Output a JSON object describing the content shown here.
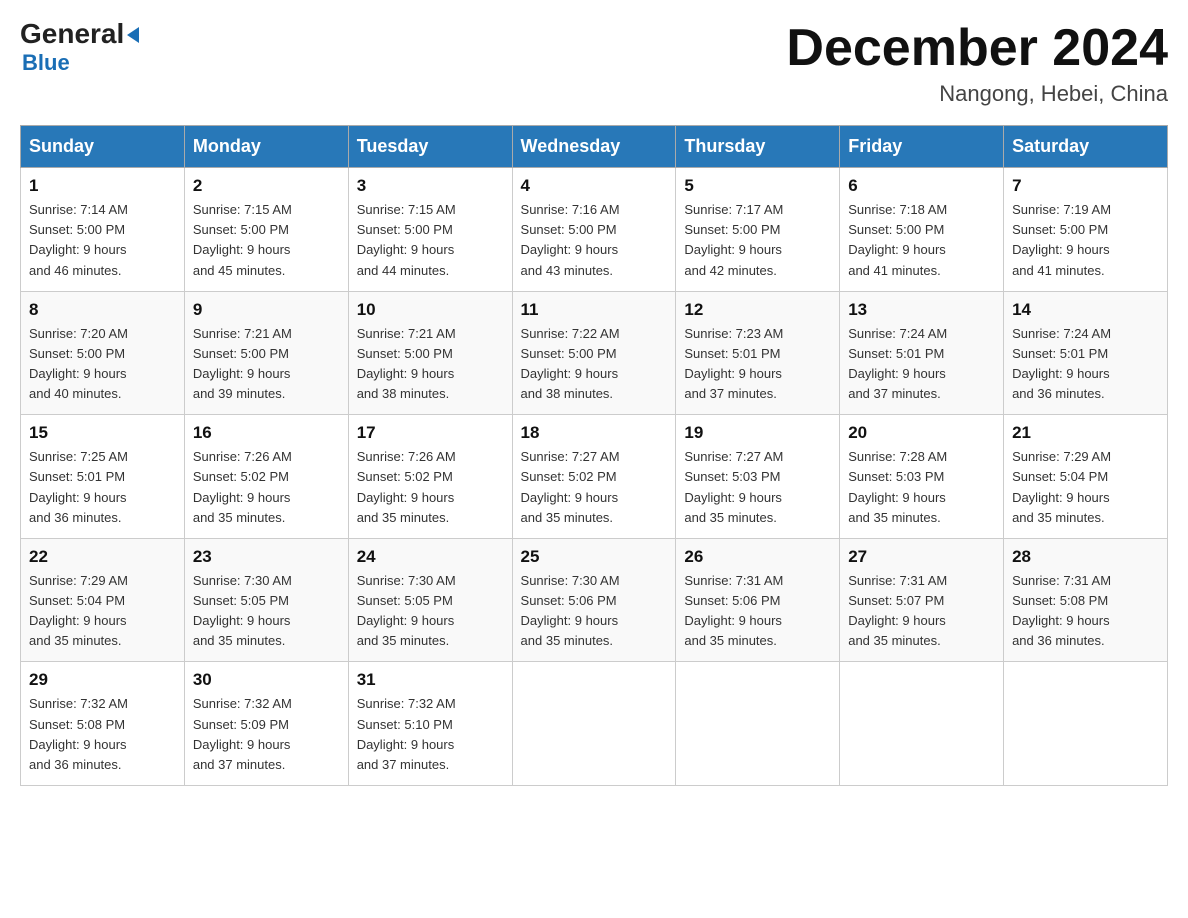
{
  "header": {
    "logo_general": "General",
    "logo_blue": "Blue",
    "month_year": "December 2024",
    "location": "Nangong, Hebei, China"
  },
  "days_of_week": [
    "Sunday",
    "Monday",
    "Tuesday",
    "Wednesday",
    "Thursday",
    "Friday",
    "Saturday"
  ],
  "weeks": [
    [
      {
        "day": "1",
        "sunrise": "7:14 AM",
        "sunset": "5:00 PM",
        "daylight": "9 hours and 46 minutes."
      },
      {
        "day": "2",
        "sunrise": "7:15 AM",
        "sunset": "5:00 PM",
        "daylight": "9 hours and 45 minutes."
      },
      {
        "day": "3",
        "sunrise": "7:15 AM",
        "sunset": "5:00 PM",
        "daylight": "9 hours and 44 minutes."
      },
      {
        "day": "4",
        "sunrise": "7:16 AM",
        "sunset": "5:00 PM",
        "daylight": "9 hours and 43 minutes."
      },
      {
        "day": "5",
        "sunrise": "7:17 AM",
        "sunset": "5:00 PM",
        "daylight": "9 hours and 42 minutes."
      },
      {
        "day": "6",
        "sunrise": "7:18 AM",
        "sunset": "5:00 PM",
        "daylight": "9 hours and 41 minutes."
      },
      {
        "day": "7",
        "sunrise": "7:19 AM",
        "sunset": "5:00 PM",
        "daylight": "9 hours and 41 minutes."
      }
    ],
    [
      {
        "day": "8",
        "sunrise": "7:20 AM",
        "sunset": "5:00 PM",
        "daylight": "9 hours and 40 minutes."
      },
      {
        "day": "9",
        "sunrise": "7:21 AM",
        "sunset": "5:00 PM",
        "daylight": "9 hours and 39 minutes."
      },
      {
        "day": "10",
        "sunrise": "7:21 AM",
        "sunset": "5:00 PM",
        "daylight": "9 hours and 38 minutes."
      },
      {
        "day": "11",
        "sunrise": "7:22 AM",
        "sunset": "5:00 PM",
        "daylight": "9 hours and 38 minutes."
      },
      {
        "day": "12",
        "sunrise": "7:23 AM",
        "sunset": "5:01 PM",
        "daylight": "9 hours and 37 minutes."
      },
      {
        "day": "13",
        "sunrise": "7:24 AM",
        "sunset": "5:01 PM",
        "daylight": "9 hours and 37 minutes."
      },
      {
        "day": "14",
        "sunrise": "7:24 AM",
        "sunset": "5:01 PM",
        "daylight": "9 hours and 36 minutes."
      }
    ],
    [
      {
        "day": "15",
        "sunrise": "7:25 AM",
        "sunset": "5:01 PM",
        "daylight": "9 hours and 36 minutes."
      },
      {
        "day": "16",
        "sunrise": "7:26 AM",
        "sunset": "5:02 PM",
        "daylight": "9 hours and 35 minutes."
      },
      {
        "day": "17",
        "sunrise": "7:26 AM",
        "sunset": "5:02 PM",
        "daylight": "9 hours and 35 minutes."
      },
      {
        "day": "18",
        "sunrise": "7:27 AM",
        "sunset": "5:02 PM",
        "daylight": "9 hours and 35 minutes."
      },
      {
        "day": "19",
        "sunrise": "7:27 AM",
        "sunset": "5:03 PM",
        "daylight": "9 hours and 35 minutes."
      },
      {
        "day": "20",
        "sunrise": "7:28 AM",
        "sunset": "5:03 PM",
        "daylight": "9 hours and 35 minutes."
      },
      {
        "day": "21",
        "sunrise": "7:29 AM",
        "sunset": "5:04 PM",
        "daylight": "9 hours and 35 minutes."
      }
    ],
    [
      {
        "day": "22",
        "sunrise": "7:29 AM",
        "sunset": "5:04 PM",
        "daylight": "9 hours and 35 minutes."
      },
      {
        "day": "23",
        "sunrise": "7:30 AM",
        "sunset": "5:05 PM",
        "daylight": "9 hours and 35 minutes."
      },
      {
        "day": "24",
        "sunrise": "7:30 AM",
        "sunset": "5:05 PM",
        "daylight": "9 hours and 35 minutes."
      },
      {
        "day": "25",
        "sunrise": "7:30 AM",
        "sunset": "5:06 PM",
        "daylight": "9 hours and 35 minutes."
      },
      {
        "day": "26",
        "sunrise": "7:31 AM",
        "sunset": "5:06 PM",
        "daylight": "9 hours and 35 minutes."
      },
      {
        "day": "27",
        "sunrise": "7:31 AM",
        "sunset": "5:07 PM",
        "daylight": "9 hours and 35 minutes."
      },
      {
        "day": "28",
        "sunrise": "7:31 AM",
        "sunset": "5:08 PM",
        "daylight": "9 hours and 36 minutes."
      }
    ],
    [
      {
        "day": "29",
        "sunrise": "7:32 AM",
        "sunset": "5:08 PM",
        "daylight": "9 hours and 36 minutes."
      },
      {
        "day": "30",
        "sunrise": "7:32 AM",
        "sunset": "5:09 PM",
        "daylight": "9 hours and 37 minutes."
      },
      {
        "day": "31",
        "sunrise": "7:32 AM",
        "sunset": "5:10 PM",
        "daylight": "9 hours and 37 minutes."
      },
      null,
      null,
      null,
      null
    ]
  ],
  "labels": {
    "sunrise": "Sunrise:",
    "sunset": "Sunset:",
    "daylight": "Daylight:"
  }
}
